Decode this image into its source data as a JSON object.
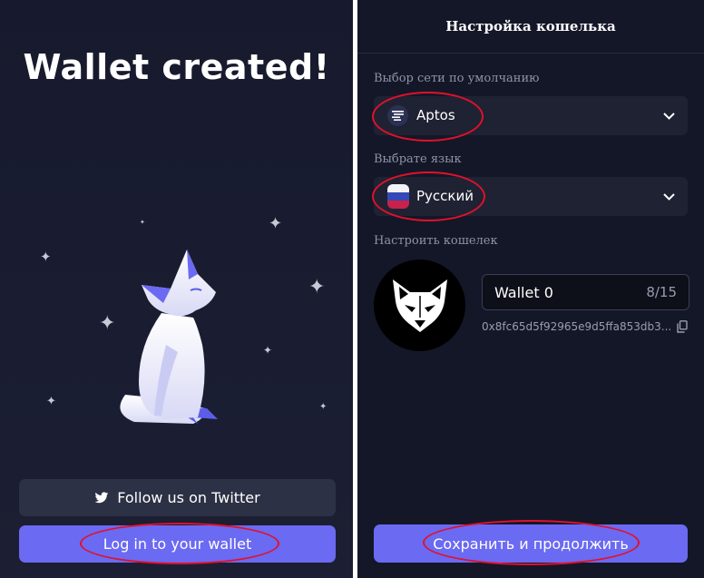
{
  "left": {
    "title": "Wallet created!",
    "twitter_button": "Follow us on Twitter",
    "login_button": "Log in to your wallet",
    "illustration_icon": "fox-illustration",
    "colors": {
      "background": "#1a1d31",
      "primary": "#6b6af2",
      "secondary_button": "#2d3145"
    }
  },
  "right": {
    "header": "Настройка кошелька",
    "network_label": "Выбор сети по умолчанию",
    "network_value": "Aptos",
    "network_icon": "aptos-icon",
    "language_label": "Выбрате язык",
    "language_value": "Русский",
    "language_icon": "russian-flag-icon",
    "wallet_label": "Настроить кошелек",
    "avatar_icon": "fox-avatar-icon",
    "wallet_name": "Wallet 0",
    "name_counter": "8/15",
    "address": "0x8fc65d5f92965e9d5ffa853db3...",
    "copy_icon": "copy-icon",
    "save_button": "Сохранить и продолжить",
    "colors": {
      "background": "#141728",
      "select_bg": "#1f2233",
      "primary": "#6b6af2",
      "annotation": "#e0112b"
    }
  }
}
